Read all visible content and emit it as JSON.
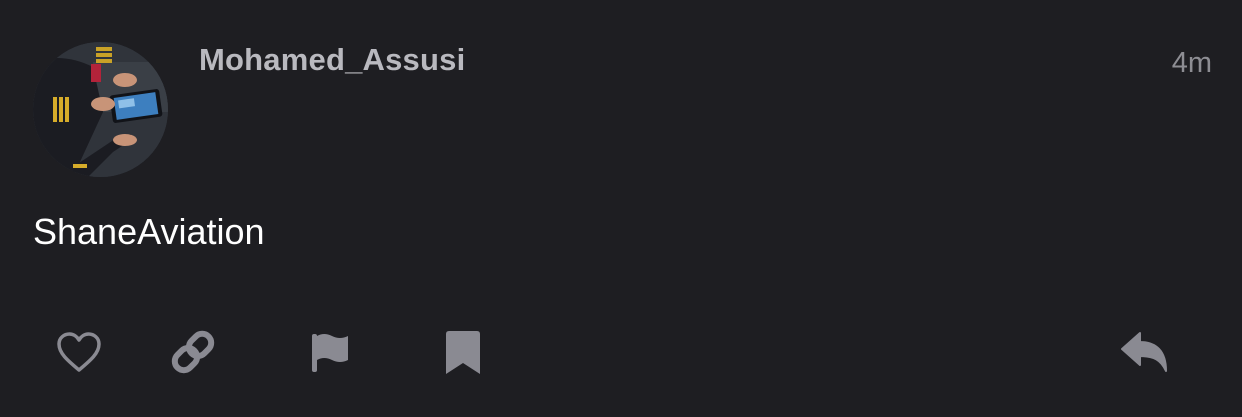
{
  "post": {
    "author": {
      "username": "Mohamed_Assusi",
      "avatar_icon": "pilot-avatar"
    },
    "timestamp": "4m",
    "content": "ShaneAviation"
  },
  "actions": [
    {
      "id": "like",
      "icon": "heart-icon"
    },
    {
      "id": "share-link",
      "icon": "link-icon"
    },
    {
      "id": "flag",
      "icon": "flag-icon"
    },
    {
      "id": "bookmark",
      "icon": "bookmark-icon"
    },
    {
      "id": "reply",
      "icon": "reply-icon"
    }
  ],
  "colors": {
    "background": "#1e1e22",
    "username": "#b9b9bf",
    "timestamp": "#8d8d93",
    "content": "#ffffff",
    "icon": "#8a8a92"
  }
}
